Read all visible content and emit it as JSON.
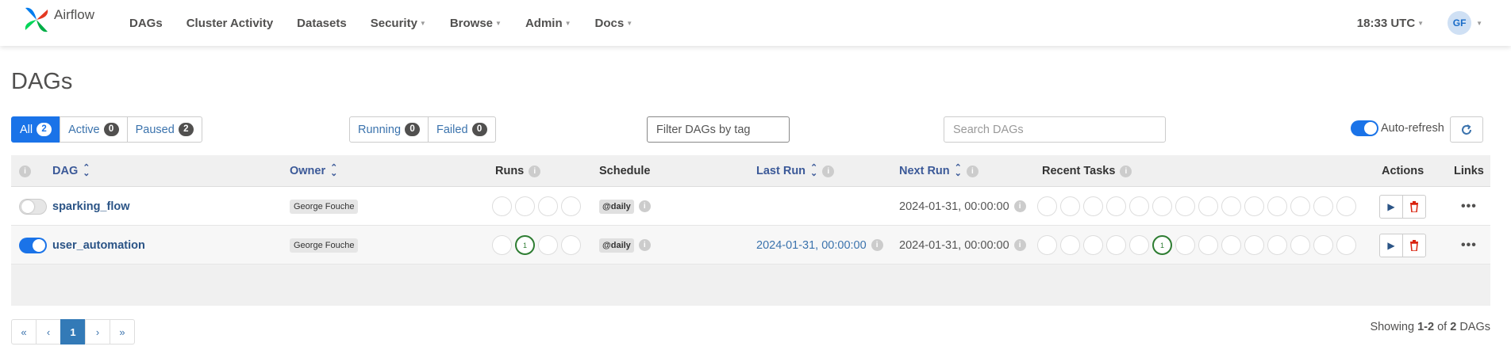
{
  "navbar": {
    "brand": "Airflow",
    "items": [
      {
        "label": "DAGs",
        "dropdown": false
      },
      {
        "label": "Cluster Activity",
        "dropdown": false
      },
      {
        "label": "Datasets",
        "dropdown": false
      },
      {
        "label": "Security",
        "dropdown": true
      },
      {
        "label": "Browse",
        "dropdown": true
      },
      {
        "label": "Admin",
        "dropdown": true
      },
      {
        "label": "Docs",
        "dropdown": true
      }
    ],
    "clock": "18:33 UTC",
    "user_initials": "GF"
  },
  "page_title": "DAGs",
  "filters": {
    "status": [
      {
        "label": "All",
        "count": "2",
        "active": true
      },
      {
        "label": "Active",
        "count": "0",
        "active": false
      },
      {
        "label": "Paused",
        "count": "2",
        "active": false
      }
    ],
    "state": [
      {
        "label": "Running",
        "count": "0"
      },
      {
        "label": "Failed",
        "count": "0"
      }
    ],
    "tag_placeholder": "Filter DAGs by tag",
    "search_placeholder": "Search DAGs",
    "autorefresh_label": "Auto-refresh"
  },
  "table": {
    "headers": {
      "dag": "DAG",
      "owner": "Owner",
      "runs": "Runs",
      "schedule": "Schedule",
      "last_run": "Last Run",
      "next_run": "Next Run",
      "recent_tasks": "Recent Tasks",
      "actions": "Actions",
      "links": "Links"
    },
    "rows": [
      {
        "enabled": false,
        "dag_id": "sparking_flow",
        "owner": "George Fouche",
        "runs": [
          "",
          "",
          "",
          ""
        ],
        "schedule": "@daily",
        "last_run": "",
        "next_run": "2024-01-31, 00:00:00",
        "recent_tasks": [
          "",
          "",
          "",
          "",
          "",
          "",
          "",
          "",
          "",
          "",
          "",
          "",
          "",
          ""
        ]
      },
      {
        "enabled": true,
        "dag_id": "user_automation",
        "owner": "George Fouche",
        "runs": [
          "",
          "1",
          "",
          ""
        ],
        "schedule": "@daily",
        "last_run": "2024-01-31, 00:00:00",
        "next_run": "2024-01-31, 00:00:00",
        "recent_tasks": [
          "",
          "",
          "",
          "",
          "",
          "1",
          "",
          "",
          "",
          "",
          "",
          "",
          "",
          ""
        ]
      }
    ]
  },
  "pagination": {
    "buttons": [
      "«",
      "‹",
      "1",
      "›",
      "»"
    ],
    "current": "1"
  },
  "showing": {
    "prefix": "Showing ",
    "range": "1-2",
    "middle": " of ",
    "total": "2",
    "suffix": " DAGs"
  },
  "colors": {
    "accent": "#1a73e8",
    "success": "#2e7d32",
    "delete": "#d9230f"
  }
}
